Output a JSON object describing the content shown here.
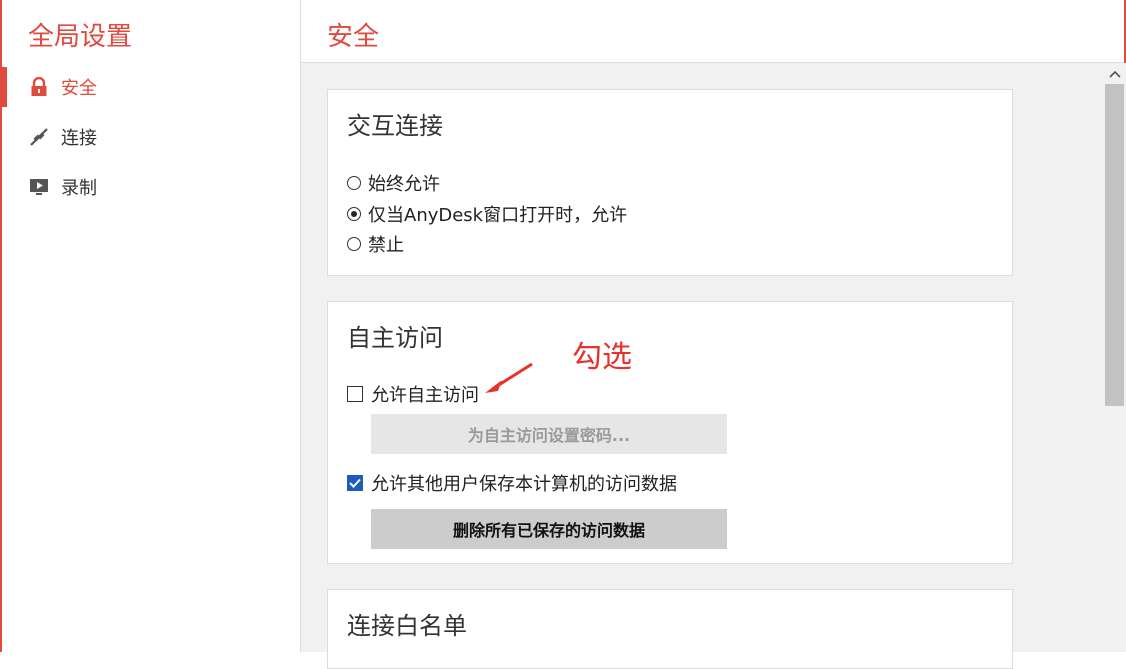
{
  "sidebar": {
    "title": "全局设置",
    "items": [
      {
        "label": "安全",
        "icon": "lock-icon",
        "active": true
      },
      {
        "label": "连接",
        "icon": "connection-icon",
        "active": false
      },
      {
        "label": "录制",
        "icon": "recording-icon",
        "active": false
      }
    ]
  },
  "main": {
    "title": "安全",
    "interactive": {
      "title": "交互连接",
      "options": [
        "始终允许",
        "仅当AnyDesk窗口打开时，允许",
        "禁止"
      ],
      "selected": "仅当AnyDesk窗口打开时，允许"
    },
    "unattended": {
      "title": "自主访问",
      "allow_label": "允许自主访问",
      "allow_checked": false,
      "set_password_label": "为自主访问设置密码...",
      "save_data_label": "允许其他用户保存本计算机的访问数据",
      "save_data_checked": true,
      "delete_label": "删除所有已保存的访问数据"
    },
    "whitelist": {
      "title": "连接白名单"
    }
  },
  "annotation": {
    "text": "勾选"
  },
  "colors": {
    "accent": "#e04a3f",
    "checkbox_checked": "#1e5bbf",
    "annotation": "#e8312a"
  }
}
